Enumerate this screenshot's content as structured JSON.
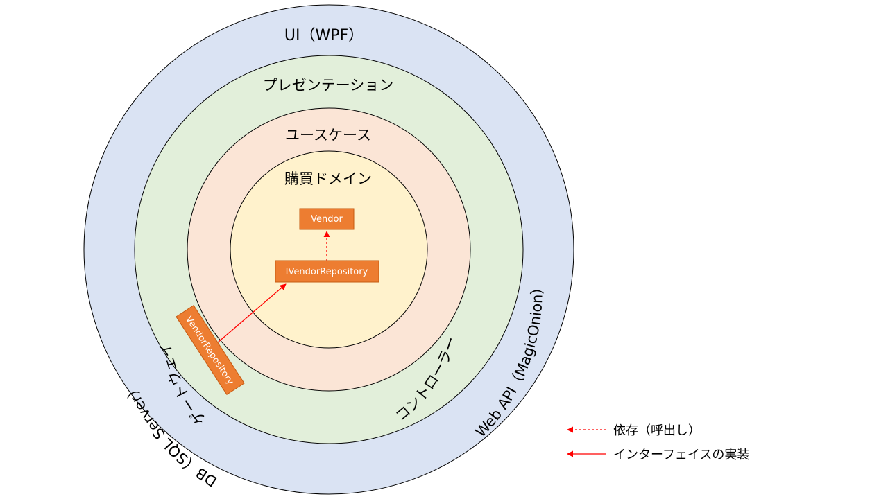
{
  "rings": {
    "ui": "UI（WPF）",
    "presentation": "プレゼンテーション",
    "usecase": "ユースケース",
    "domain": "購買ドメイン"
  },
  "curved": {
    "controller": "コントローラー",
    "gateway": "ゲートウェイ",
    "web_api": "Web API（MagicOnion）",
    "db": "DB（SQL Server）"
  },
  "boxes": {
    "vendor": "Vendor",
    "ivendor_repository": "IVendorRepository",
    "vendor_repository": "VendorRepository"
  },
  "legend": {
    "dependency": "依存（呼出し）",
    "implementation": "インターフェイスの実装"
  },
  "colors": {
    "ui_ring": "#dae3f3",
    "presentation_ring": "#e2efda",
    "usecase_ring": "#fbe5d6",
    "domain_ring": "#fff2cc",
    "box_fill": "#ed7d31",
    "box_stroke": "#c55a11",
    "arrow": "#ff0000"
  }
}
